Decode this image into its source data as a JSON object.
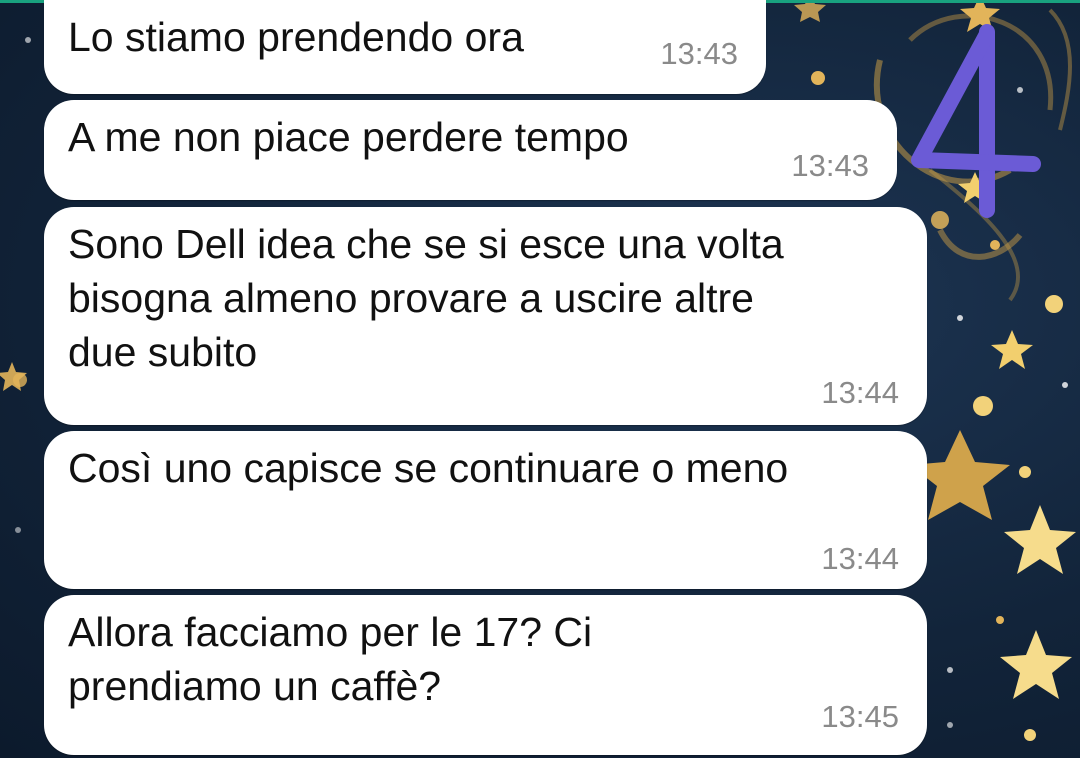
{
  "chat": {
    "messages": [
      {
        "text": "Lo stiamo prendendo ora",
        "time": "13:43"
      },
      {
        "text": "A me non piace perdere tempo",
        "time": "13:43"
      },
      {
        "text": "Sono Dell idea che se si esce una volta\nbisogna almeno provare a uscire altre\ndue subito",
        "time": "13:44"
      },
      {
        "text": "Così uno capisce se continuare o meno",
        "time": "13:44"
      },
      {
        "text": "Allora facciamo per le 17? Ci\nprendiamo un caffè?",
        "time": "13:45"
      }
    ]
  },
  "annotation": {
    "number": "4",
    "color": "#6b5bd6"
  },
  "colors": {
    "wallpaper": "#12243a",
    "bubble": "#ffffff",
    "accent": "#19a27f",
    "star": "#e8b84a"
  },
  "wallpaper": {
    "pattern": "gold stars and moons"
  }
}
